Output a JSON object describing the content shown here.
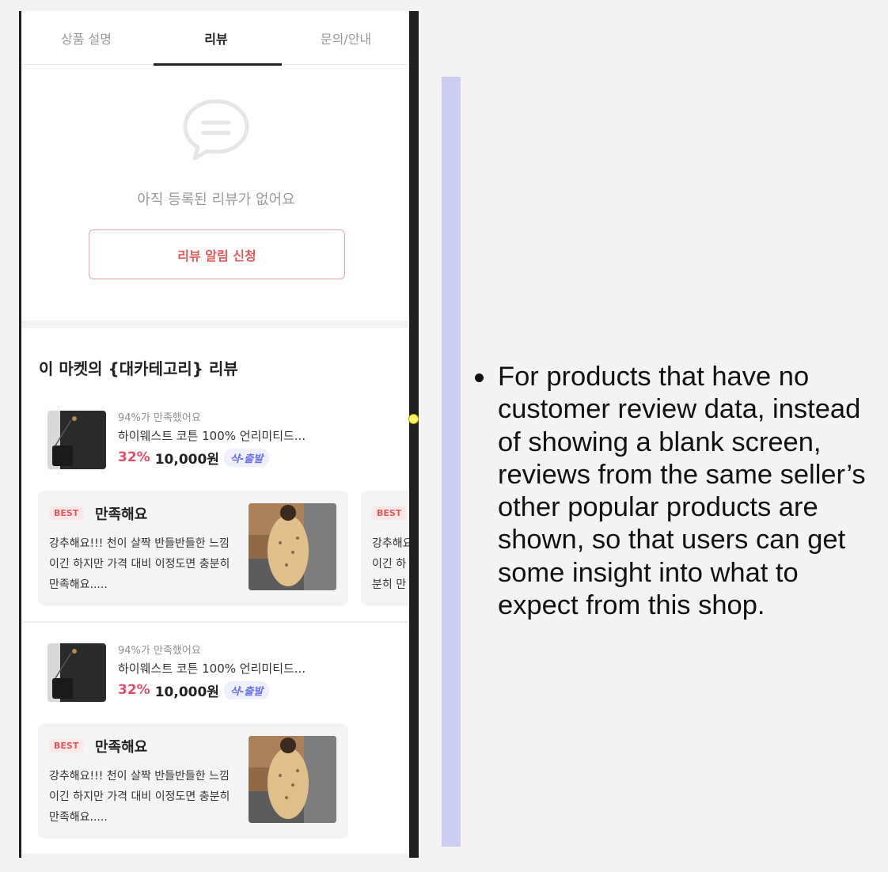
{
  "tabs": [
    {
      "label": "상품 설명"
    },
    {
      "label": "리뷰"
    },
    {
      "label": "문의/안내"
    }
  ],
  "empty_state": {
    "icon": "chat-bubble-icon",
    "message": "아직 등록된 리뷰가 없어요",
    "button_label": "리뷰 알림 신청"
  },
  "section": {
    "title": "이 마켓의 {대카테고리} 리뷰"
  },
  "products": [
    {
      "satisfaction": "94%가 만족했어요",
      "name": "하이웨스트 코튼 100% 언리미티드...",
      "discount": "32%",
      "price": "10,000원",
      "shipping": "샥-출발",
      "reviews": [
        {
          "badge": "BEST",
          "title": "만족해요",
          "body": "강추해요!!! 천이 살짝 반들반들한 느낌이긴 하지만 가격 대비 이정도면 충분히 만족해요....."
        },
        {
          "badge": "BEST",
          "body": "강추해요 낌이긴 하 충분히 만"
        }
      ]
    },
    {
      "satisfaction": "94%가 만족했어요",
      "name": "하이웨스트 코튼 100% 언리미티드...",
      "discount": "32%",
      "price": "10,000원",
      "shipping": "샥-출발",
      "reviews": [
        {
          "badge": "BEST",
          "title": "만족해요",
          "body": "강추해요!!! 천이 살짝 반들반들한 느낌이긴 하지만 가격 대비 이정도면 충분히 만족해요....."
        }
      ]
    }
  ],
  "annotation": {
    "text": "For products that have no customer review data, instead of showing a blank screen, reviews from the same seller’s other popular products are shown, so that users can get some insight into what to expect from this shop."
  },
  "colors": {
    "accent_bar": "#cdcdf0",
    "discount": "#e0506a",
    "button_border": "#f0a5a5",
    "shipping_badge": "#6a72e8"
  }
}
